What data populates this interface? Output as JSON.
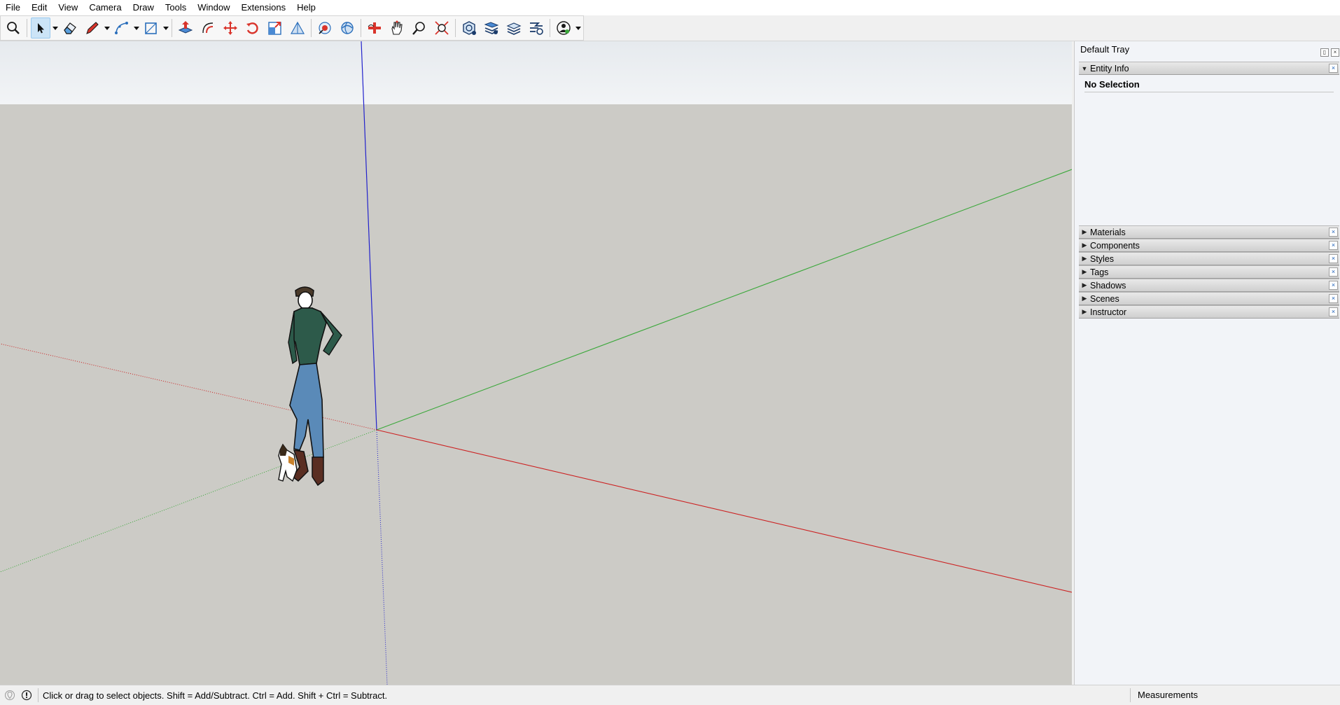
{
  "menu": [
    "File",
    "Edit",
    "View",
    "Camera",
    "Draw",
    "Tools",
    "Window",
    "Extensions",
    "Help"
  ],
  "toolbar": {
    "tools": [
      {
        "name": "search-tool-icon"
      },
      {
        "name": "select-tool-icon",
        "active": true,
        "dropdown": true
      },
      {
        "name": "eraser-tool-icon"
      },
      {
        "name": "pencil-line-tool-icon",
        "dropdown": true
      },
      {
        "name": "arc-tool-icon",
        "dropdown": true
      },
      {
        "name": "rectangle-tool-icon",
        "dropdown": true
      },
      {
        "name": "push-pull-tool-icon"
      },
      {
        "name": "offset-tool-icon"
      },
      {
        "name": "move-tool-icon"
      },
      {
        "name": "rotate-tool-icon"
      },
      {
        "name": "scale-tool-icon"
      },
      {
        "name": "tape-measure-tool-icon"
      },
      {
        "name": "paint-bucket-tool-icon"
      },
      {
        "name": "orbit-tool-icon"
      },
      {
        "name": "look-around-tool-icon"
      },
      {
        "name": "pan-tool-icon"
      },
      {
        "name": "zoom-tool-icon"
      },
      {
        "name": "zoom-extents-tool-icon"
      },
      {
        "name": "3d-warehouse-icon"
      },
      {
        "name": "extension-warehouse-icon"
      },
      {
        "name": "layout-icon"
      },
      {
        "name": "extension-manager-icon"
      },
      {
        "name": "account-icon",
        "dropdown": true
      }
    ]
  },
  "tray": {
    "title": "Default Tray",
    "entity_info": {
      "label": "Entity Info",
      "status": "No Selection"
    },
    "panels": [
      "Materials",
      "Components",
      "Styles",
      "Tags",
      "Shadows",
      "Scenes",
      "Instructor"
    ]
  },
  "statusbar": {
    "hint": "Click or drag to select objects. Shift = Add/Subtract. Ctrl = Add. Shift + Ctrl = Subtract.",
    "measurements_label": "Measurements"
  },
  "colors": {
    "x_axis": "#cc2222",
    "y_axis": "#3aa83a",
    "z_axis": "#2222cc",
    "ground": "#cccbc6",
    "sky": "#eef0f2"
  }
}
